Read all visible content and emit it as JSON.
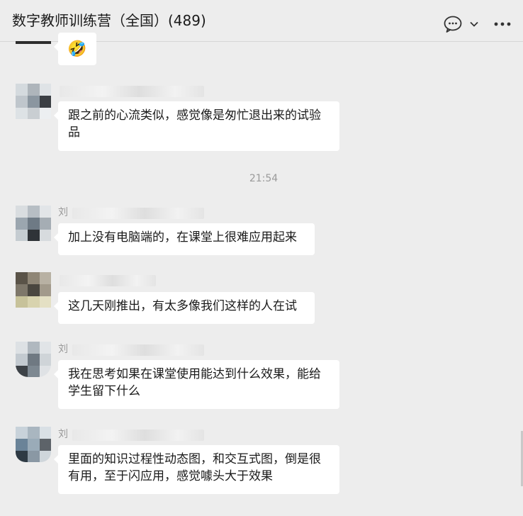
{
  "header": {
    "title": "数字教师训练营（全国）(489)",
    "chat_icon": "chat-bubble-icon",
    "chevron_icon": "chevron-down-icon",
    "more_icon": "more-dots-icon"
  },
  "messages": [
    {
      "sender": "",
      "text": "🤣"
    },
    {
      "sender": "",
      "text": "跟之前的心流类似，感觉像是匆忙退出来的试验品"
    },
    {
      "sender": "刘",
      "text": "加上没有电脑端的，在课堂上很难应用起来"
    },
    {
      "sender": "",
      "text": "这几天刚推出，有太多像我们这样的人在试"
    },
    {
      "sender": "刘",
      "text": "我在思考如果在课堂使用能达到什么效果，能给学生留下什么"
    },
    {
      "sender": "刘",
      "text": "里面的知识过程性动态图，和交互式图，倒是很有用，至于闪应用，感觉噱头大于效果"
    }
  ],
  "timestamp": "21:54"
}
